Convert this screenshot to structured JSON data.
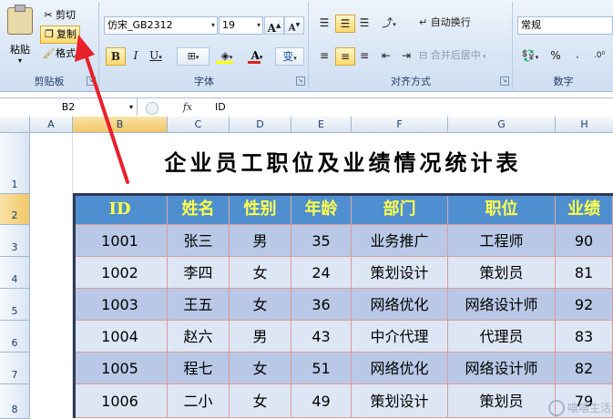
{
  "ribbon": {
    "clipboard": {
      "label": "剪贴板",
      "paste": "粘贴",
      "cut": "剪切",
      "copy": "复制",
      "format_painter": "格式"
    },
    "font": {
      "label": "字体",
      "font_name": "仿宋_GB2312",
      "font_size": "19",
      "grow": "A",
      "shrink": "A",
      "bold": "B",
      "italic": "I",
      "underline": "U",
      "font_color_glyph": "A",
      "phonetic": "变"
    },
    "alignment": {
      "label": "对齐方式",
      "wrap_text": "自动换行",
      "merge_center": "合并后居中"
    },
    "number": {
      "label": "数字",
      "format": "常规",
      "percent": "%"
    }
  },
  "formula_bar": {
    "name_box": "B2",
    "fx": "fx",
    "content": "ID"
  },
  "columns": [
    "A",
    "B",
    "C",
    "D",
    "E",
    "F",
    "G",
    "H"
  ],
  "rows": [
    "1",
    "2",
    "3",
    "4",
    "5",
    "6",
    "7",
    "8"
  ],
  "sheet": {
    "title": "企业员工职位及业绩情况统计表",
    "headers": [
      "ID",
      "姓名",
      "性别",
      "年龄",
      "部门",
      "职位",
      "业绩"
    ],
    "data": [
      [
        "1001",
        "张三",
        "男",
        "35",
        "业务推广",
        "工程师",
        "90"
      ],
      [
        "1002",
        "李四",
        "女",
        "24",
        "策划设计",
        "策划员",
        "81"
      ],
      [
        "1003",
        "王五",
        "女",
        "36",
        "网络优化",
        "网络设计师",
        "92"
      ],
      [
        "1004",
        "赵六",
        "男",
        "43",
        "中介代理",
        "代理员",
        "83"
      ],
      [
        "1005",
        "程七",
        "女",
        "51",
        "网络优化",
        "网络设计师",
        "82"
      ],
      [
        "1006",
        "二小",
        "女",
        "49",
        "策划设计",
        "策划员",
        "79"
      ]
    ]
  },
  "colors": {
    "header_fill": "#4f8fd0",
    "header_text": "#ffff4a",
    "row_odd": "#b9c8e6",
    "row_even": "#dde6f5",
    "annotation_arrow": "#e8202a"
  },
  "watermark": "嘻嘻生活"
}
